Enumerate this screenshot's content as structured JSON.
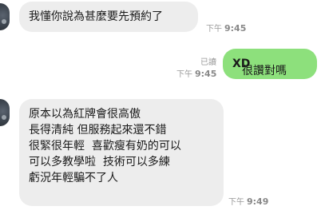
{
  "messages": [
    {
      "text": "我懂你說為甚麼要先預約了",
      "period": "下午",
      "time": "9:45"
    },
    {
      "text": "很讚對嗎",
      "text_bold": "XD",
      "read_label": "已讀",
      "period": "下午",
      "time": "9:45"
    },
    {
      "lines": [
        "原本以為紅牌會很高傲",
        "長得清純 但服務起來還不錯",
        "很緊很年輕  喜歡瘦有奶的可以",
        "可以多教學啦  技術可以多練",
        "虧況年輕騙不了人"
      ],
      "period": "下午",
      "time": "9:49"
    }
  ],
  "colors": {
    "incoming_bubble": "#ededed",
    "outgoing_bubble": "#8de07c",
    "meta_text": "#9a9a9a"
  }
}
